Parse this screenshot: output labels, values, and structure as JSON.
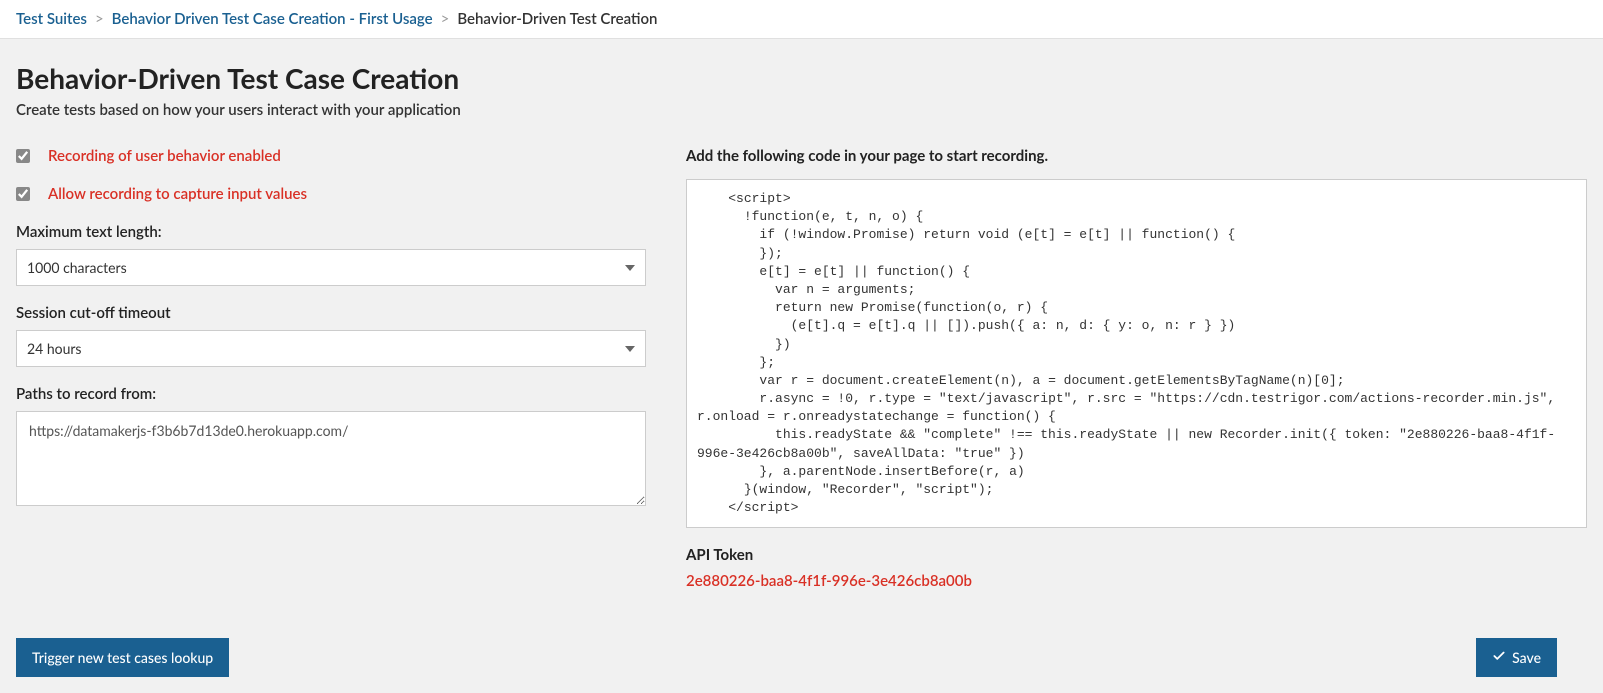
{
  "breadcrumb": {
    "root": "Test Suites",
    "parent": "Behavior Driven Test Case Creation - First Usage",
    "current": "Behavior-Driven Test Creation"
  },
  "page": {
    "title": "Behavior-Driven Test Case Creation",
    "subtitle": "Create tests based on how your users interact with your application"
  },
  "form": {
    "recording_enabled_label": "Recording of user behavior enabled",
    "capture_input_label": "Allow recording to capture input values",
    "max_text_length_label": "Maximum text length:",
    "max_text_length_value": "1000 characters",
    "session_cutoff_label": "Session cut-off timeout",
    "session_cutoff_value": "24 hours",
    "paths_label": "Paths to record from:",
    "paths_value": "https://datamakerjs-f3b6b7d13de0.herokuapp.com/"
  },
  "right": {
    "instruction": "Add the following code in your page to start recording.",
    "code": "    <script>\n      !function(e, t, n, o) {\n        if (!window.Promise) return void (e[t] = e[t] || function() {\n        });\n        e[t] = e[t] || function() {\n          var n = arguments;\n          return new Promise(function(o, r) {\n            (e[t].q = e[t].q || []).push({ a: n, d: { y: o, n: r } })\n          })\n        };\n        var r = document.createElement(n), a = document.getElementsByTagName(n)[0];\n        r.async = !0, r.type = \"text/javascript\", r.src = \"https://cdn.testrigor.com/actions-recorder.min.js\", r.onload = r.onreadystatechange = function() {\n          this.readyState && \"complete\" !== this.readyState || new Recorder.init({ token: \"2e880226-baa8-4f1f-996e-3e426cb8a00b\", saveAllData: \"true\" })\n        }, a.parentNode.insertBefore(r, a)\n      }(window, \"Recorder\", \"script\");\n    </script>",
    "api_token_label": "API Token",
    "api_token_value": "2e880226-baa8-4f1f-996e-3e426cb8a00b"
  },
  "buttons": {
    "trigger_lookup": "Trigger new test cases lookup",
    "save": "Save"
  }
}
